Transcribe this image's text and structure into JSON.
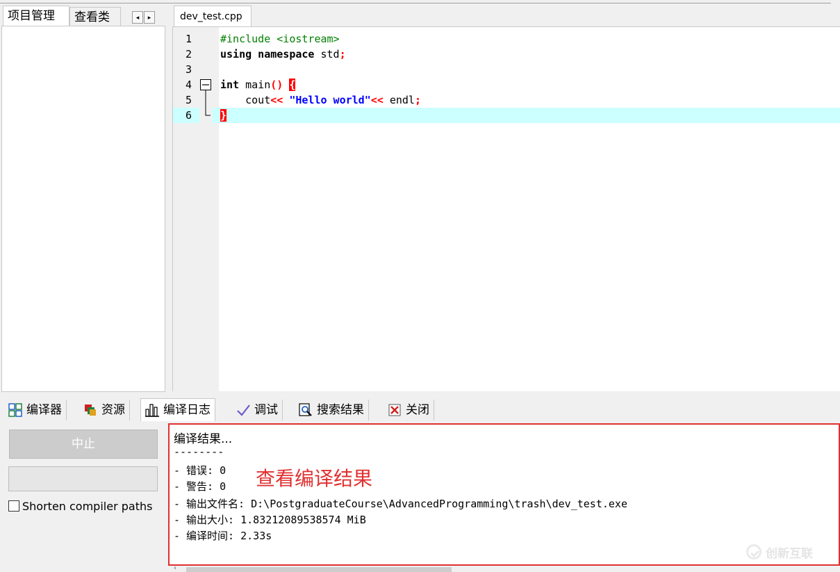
{
  "left_panel": {
    "tabs": [
      {
        "label": "项目管理",
        "active": true
      },
      {
        "label": "查看类",
        "active": false
      }
    ],
    "nav_left": "◂",
    "nav_right": "▸"
  },
  "editor": {
    "file_tab": "dev_test.cpp",
    "lines": [
      {
        "no": "1",
        "text": "#include <iostream>"
      },
      {
        "no": "2",
        "text": "using namespace std;"
      },
      {
        "no": "3",
        "text": ""
      },
      {
        "no": "4",
        "text": "int main() {"
      },
      {
        "no": "5",
        "text": "    cout<< \"Hello world\"<< endl;"
      },
      {
        "no": "6",
        "text": "}"
      }
    ],
    "highlighted_line": 6
  },
  "bottom_tabs": [
    {
      "label": "编译器",
      "icon": "grid-icon"
    },
    {
      "label": "资源",
      "icon": "resources-icon"
    },
    {
      "label": "编译日志",
      "icon": "bar-chart-icon",
      "active": true
    },
    {
      "label": "调试",
      "icon": "check-icon"
    },
    {
      "label": "搜索结果",
      "icon": "search-icon"
    },
    {
      "label": "关闭",
      "icon": "close-icon"
    }
  ],
  "controls": {
    "abort_label": "中止",
    "shorten_label": "Shorten compiler paths",
    "shorten_checked": false,
    "progress": 0
  },
  "log": {
    "lines": [
      "编译结果...",
      "--------",
      "- 错误: 0",
      "- 警告: 0",
      "- 输出文件名: D:\\PostgraduateCourse\\AdvancedProgramming\\trash\\dev_test.exe",
      "- 输出大小: 1.83212089538574 MiB",
      "- 编译时间: 2.33s"
    ],
    "annotation": "查看编译结果"
  },
  "watermark": "创新互联",
  "colors": {
    "highlight_line": "#ccffff",
    "annotation_red": "#e03030",
    "brace_red": "#ff0000",
    "string_blue": "#0000ff",
    "preproc_green": "#008000"
  }
}
